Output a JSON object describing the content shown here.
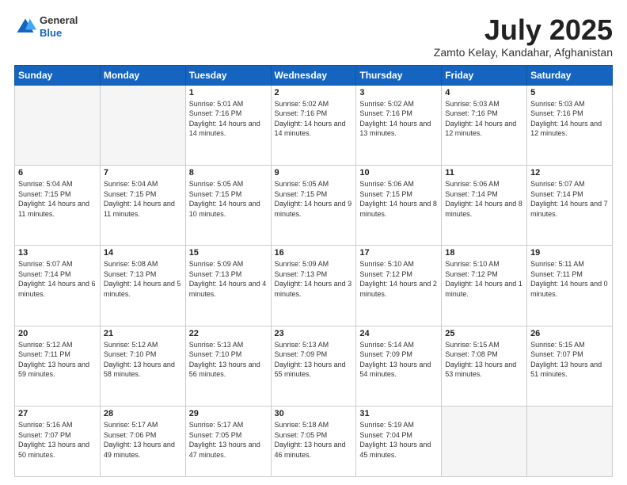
{
  "header": {
    "logo": {
      "general": "General",
      "blue": "Blue"
    },
    "title": "July 2025",
    "location": "Zamto Kelay, Kandahar, Afghanistan"
  },
  "weekdays": [
    "Sunday",
    "Monday",
    "Tuesday",
    "Wednesday",
    "Thursday",
    "Friday",
    "Saturday"
  ],
  "weeks": [
    [
      {
        "day": "",
        "empty": true
      },
      {
        "day": "",
        "empty": true
      },
      {
        "day": "1",
        "sunrise": "5:01 AM",
        "sunset": "7:16 PM",
        "daylight": "14 hours and 14 minutes."
      },
      {
        "day": "2",
        "sunrise": "5:02 AM",
        "sunset": "7:16 PM",
        "daylight": "14 hours and 14 minutes."
      },
      {
        "day": "3",
        "sunrise": "5:02 AM",
        "sunset": "7:16 PM",
        "daylight": "14 hours and 13 minutes."
      },
      {
        "day": "4",
        "sunrise": "5:03 AM",
        "sunset": "7:16 PM",
        "daylight": "14 hours and 12 minutes."
      },
      {
        "day": "5",
        "sunrise": "5:03 AM",
        "sunset": "7:16 PM",
        "daylight": "14 hours and 12 minutes."
      }
    ],
    [
      {
        "day": "6",
        "sunrise": "5:04 AM",
        "sunset": "7:15 PM",
        "daylight": "14 hours and 11 minutes."
      },
      {
        "day": "7",
        "sunrise": "5:04 AM",
        "sunset": "7:15 PM",
        "daylight": "14 hours and 11 minutes."
      },
      {
        "day": "8",
        "sunrise": "5:05 AM",
        "sunset": "7:15 PM",
        "daylight": "14 hours and 10 minutes."
      },
      {
        "day": "9",
        "sunrise": "5:05 AM",
        "sunset": "7:15 PM",
        "daylight": "14 hours and 9 minutes."
      },
      {
        "day": "10",
        "sunrise": "5:06 AM",
        "sunset": "7:15 PM",
        "daylight": "14 hours and 8 minutes."
      },
      {
        "day": "11",
        "sunrise": "5:06 AM",
        "sunset": "7:14 PM",
        "daylight": "14 hours and 8 minutes."
      },
      {
        "day": "12",
        "sunrise": "5:07 AM",
        "sunset": "7:14 PM",
        "daylight": "14 hours and 7 minutes."
      }
    ],
    [
      {
        "day": "13",
        "sunrise": "5:07 AM",
        "sunset": "7:14 PM",
        "daylight": "14 hours and 6 minutes."
      },
      {
        "day": "14",
        "sunrise": "5:08 AM",
        "sunset": "7:13 PM",
        "daylight": "14 hours and 5 minutes."
      },
      {
        "day": "15",
        "sunrise": "5:09 AM",
        "sunset": "7:13 PM",
        "daylight": "14 hours and 4 minutes."
      },
      {
        "day": "16",
        "sunrise": "5:09 AM",
        "sunset": "7:13 PM",
        "daylight": "14 hours and 3 minutes."
      },
      {
        "day": "17",
        "sunrise": "5:10 AM",
        "sunset": "7:12 PM",
        "daylight": "14 hours and 2 minutes."
      },
      {
        "day": "18",
        "sunrise": "5:10 AM",
        "sunset": "7:12 PM",
        "daylight": "14 hours and 1 minute."
      },
      {
        "day": "19",
        "sunrise": "5:11 AM",
        "sunset": "7:11 PM",
        "daylight": "14 hours and 0 minutes."
      }
    ],
    [
      {
        "day": "20",
        "sunrise": "5:12 AM",
        "sunset": "7:11 PM",
        "daylight": "13 hours and 59 minutes."
      },
      {
        "day": "21",
        "sunrise": "5:12 AM",
        "sunset": "7:10 PM",
        "daylight": "13 hours and 58 minutes."
      },
      {
        "day": "22",
        "sunrise": "5:13 AM",
        "sunset": "7:10 PM",
        "daylight": "13 hours and 56 minutes."
      },
      {
        "day": "23",
        "sunrise": "5:13 AM",
        "sunset": "7:09 PM",
        "daylight": "13 hours and 55 minutes."
      },
      {
        "day": "24",
        "sunrise": "5:14 AM",
        "sunset": "7:09 PM",
        "daylight": "13 hours and 54 minutes."
      },
      {
        "day": "25",
        "sunrise": "5:15 AM",
        "sunset": "7:08 PM",
        "daylight": "13 hours and 53 minutes."
      },
      {
        "day": "26",
        "sunrise": "5:15 AM",
        "sunset": "7:07 PM",
        "daylight": "13 hours and 51 minutes."
      }
    ],
    [
      {
        "day": "27",
        "sunrise": "5:16 AM",
        "sunset": "7:07 PM",
        "daylight": "13 hours and 50 minutes."
      },
      {
        "day": "28",
        "sunrise": "5:17 AM",
        "sunset": "7:06 PM",
        "daylight": "13 hours and 49 minutes."
      },
      {
        "day": "29",
        "sunrise": "5:17 AM",
        "sunset": "7:05 PM",
        "daylight": "13 hours and 47 minutes."
      },
      {
        "day": "30",
        "sunrise": "5:18 AM",
        "sunset": "7:05 PM",
        "daylight": "13 hours and 46 minutes."
      },
      {
        "day": "31",
        "sunrise": "5:19 AM",
        "sunset": "7:04 PM",
        "daylight": "13 hours and 45 minutes."
      },
      {
        "day": "",
        "empty": true
      },
      {
        "day": "",
        "empty": true
      }
    ]
  ]
}
